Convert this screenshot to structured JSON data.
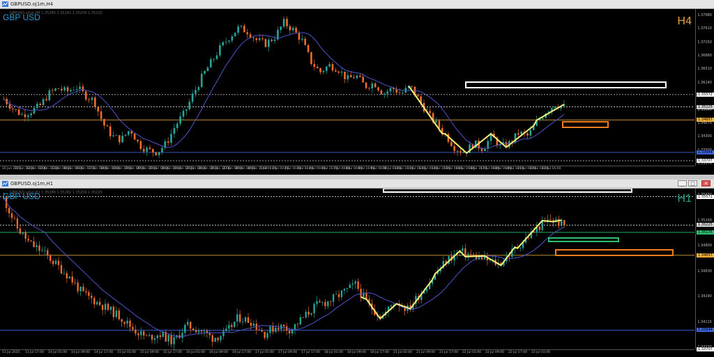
{
  "colors": {
    "bull": "#26a69a",
    "bear": "#ef6c2b",
    "ma": "#4c56c8",
    "zigzag": "#f5ee7a",
    "white_box": "#ffffff",
    "orange_box": "#f07d1a",
    "green_box": "#2fbf71",
    "level_orange": "#d9a43c",
    "level_blue": "#3b64d8",
    "level_white": "#d8d8d8",
    "symbol_text": "#2a9ad6",
    "h4_label": "#e8a33a",
    "h1_label": "#21a58a"
  },
  "top": {
    "window_title": "GBPUSD.oj1m,H4",
    "symbol": "GBP USD",
    "ohlc": "GBPUSD.oj1m,H4 1.35286 1.35282 1.35209 1.35225",
    "timeframe": "H4",
    "price_ticks": [
      "1.37980",
      "1.37610",
      "1.37250",
      "1.36880",
      "1.36510",
      "1.36140",
      "1.35410",
      "1.35040",
      "1.34670",
      "1.34300",
      "1.33930",
      "1.33570"
    ],
    "badges": [
      "1.35572",
      "1.35225",
      "1.34857",
      "1.33944",
      "1.33707"
    ],
    "time_ticks": [
      "10 Jun 2025",
      "11 Jun 08:00",
      "12 Jun 00:00",
      "12 Jun 16:00",
      "13 Jun 08:00",
      "16 Jun 00:00",
      "16 Jun 16:00",
      "17 Jun 08:00",
      "18 Jun 00:00",
      "18 Jun 16:00",
      "19 Jun 08:00",
      "20 Jun 00:00",
      "23 Jun 08:00",
      "24 Jun 00:00",
      "24 Jun 16:00",
      "25 Jun 08:00",
      "26 Jun 00:00",
      "26 Jun 16:00",
      "27 Jun 08:00",
      "30 Jun 00:00",
      "30 Jun 16:00",
      "1 Jul 08:00",
      "2 Jul 00:00",
      "2 Jul 16:00",
      "3 Jul 08:00",
      "4 Jul 00:00",
      "4 Jul 16:00",
      "7 Jul 08:00",
      "8 Jul 00:00",
      "8 Jul 16:00",
      "9 Jul 08:00",
      "10 Jul 00:00",
      "10 Jul 16:00",
      "11 Jul 08:00",
      "14 Jul 00:00",
      "14 Jul 16:00",
      "15 Jul 08:00",
      "16 Jul 00:00",
      "16 Jul 16:00",
      "17 Jul 08:00",
      "18 Jul 00:00",
      "18 Jul 16:00",
      "21 Jul 08:00",
      "22 Jul 00:00",
      "22 Jul 16:00"
    ]
  },
  "bottom": {
    "window_title": "GBPUSD.oj1m,H1",
    "symbol": "GBP USD",
    "ohlc": "GBPUSD.oj1m,H1 1.35286 1.35282 1.35209 1.35225",
    "timeframe": "H1",
    "price_ticks": [
      "1.35490",
      "1.35150",
      "1.34800",
      "1.34630",
      "1.34290",
      "1.34115",
      "1.33770"
    ],
    "badges": [
      "1.35572",
      "1.35225",
      "1.35136",
      "1.34857",
      "1.33944",
      "1.33707"
    ],
    "time_ticks": [
      "11 Jul 2025",
      "11 Jul 17:00",
      "14 Jul 01:00",
      "14 Jul 09:00",
      "14 Jul 17:00",
      "15 Jul 01:00",
      "15 Jul 09:00",
      "15 Jul 17:00",
      "16 Jul 01:00",
      "16 Jul 09:00",
      "16 Jul 17:00",
      "17 Jul 01:00",
      "17 Jul 09:00",
      "17 Jul 17:00",
      "18 Jul 01:00",
      "18 Jul 09:00",
      "18 Jul 17:00",
      "21 Jul 01:00",
      "21 Jul 09:00",
      "21 Jul 17:00",
      "22 Jul 01:00",
      "22 Jul 09:00",
      "22 Jul 17:00",
      "23 Jul 01:00"
    ]
  },
  "chart_data": [
    {
      "type": "candlestick",
      "title": "GBP USD H4",
      "ylim": [
        1.3357,
        1.3798
      ],
      "levels": [
        1.35572,
        1.35225,
        1.34857,
        1.33944,
        1.33707
      ],
      "path_close": [
        1.3545,
        1.3518,
        1.35,
        1.351,
        1.3525,
        1.356,
        1.3575,
        1.3565,
        1.358,
        1.3555,
        1.354,
        1.3475,
        1.344,
        1.343,
        1.346,
        1.3415,
        1.34,
        1.3395,
        1.342,
        1.347,
        1.3505,
        1.356,
        1.361,
        1.365,
        1.369,
        1.372,
        1.3745,
        1.3735,
        1.371,
        1.37,
        1.372,
        1.376,
        1.374,
        1.371,
        1.365,
        1.362,
        1.364,
        1.363,
        1.36,
        1.361,
        1.358,
        1.359,
        1.356,
        1.3575,
        1.356,
        1.358,
        1.354,
        1.35,
        1.347,
        1.344,
        1.3405,
        1.3395,
        1.342,
        1.3405,
        1.344,
        1.341,
        1.342,
        1.345,
        1.344,
        1.348,
        1.351,
        1.353,
        1.3522
      ]
    },
    {
      "type": "candlestick",
      "title": "GBP USD H1",
      "ylim": [
        1.3371,
        1.3567
      ],
      "levels": [
        1.35572,
        1.35225,
        1.35136,
        1.34857,
        1.33944,
        1.33707
      ],
      "path_close": [
        1.3555,
        1.352,
        1.35,
        1.349,
        1.3475,
        1.346,
        1.344,
        1.343,
        1.342,
        1.341,
        1.3395,
        1.3385,
        1.339,
        1.338,
        1.34,
        1.3395,
        1.3385,
        1.339,
        1.341,
        1.3405,
        1.339,
        1.34,
        1.3395,
        1.341,
        1.3425,
        1.343,
        1.344,
        1.345,
        1.3425,
        1.341,
        1.343,
        1.342,
        1.344,
        1.346,
        1.348,
        1.349,
        1.3485,
        1.348,
        1.3475,
        1.349,
        1.3505,
        1.352,
        1.353,
        1.3522
      ]
    }
  ]
}
